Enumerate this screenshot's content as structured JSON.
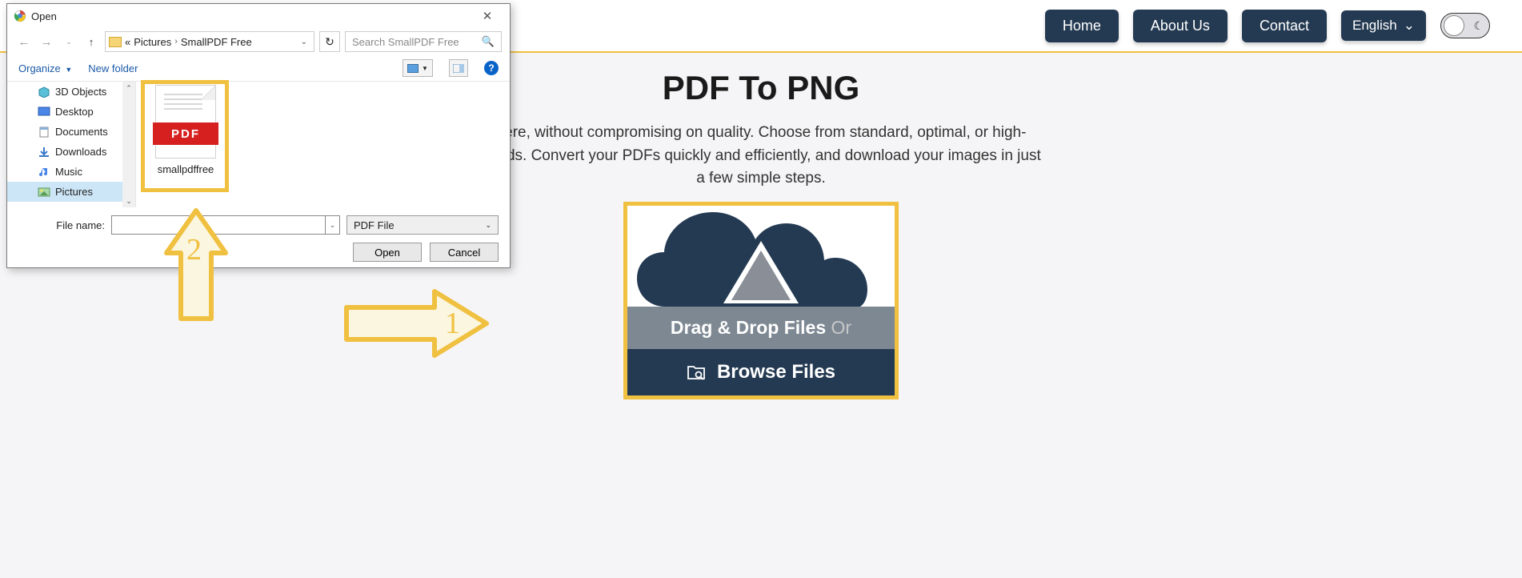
{
  "nav": {
    "home": "Home",
    "about": "About Us",
    "contact": "Contact",
    "language": "English"
  },
  "page": {
    "title": "PDF To PNG",
    "desc_line1": "here, without compromising on quality. Choose from standard, optimal, or high-",
    "desc_line2": "needs. Convert your PDFs quickly and efficiently, and download your images in just",
    "desc_line3": "a few simple steps."
  },
  "dropzone": {
    "dragdrop": "Drag & Drop Files",
    "or": "Or",
    "browse": "Browse Files"
  },
  "dialog": {
    "title": "Open",
    "breadcrumb": {
      "root": "Pictures",
      "current": "SmallPDF Free",
      "prefix": "«"
    },
    "search_placeholder": "Search SmallPDF Free",
    "organize": "Organize",
    "new_folder": "New folder",
    "tree": {
      "items": [
        {
          "label": "3D Objects",
          "icon": "cube"
        },
        {
          "label": "Desktop",
          "icon": "desktop"
        },
        {
          "label": "Documents",
          "icon": "doc"
        },
        {
          "label": "Downloads",
          "icon": "download"
        },
        {
          "label": "Music",
          "icon": "music"
        },
        {
          "label": "Pictures",
          "icon": "picture",
          "selected": true
        }
      ]
    },
    "file": {
      "name": "smallpdffree",
      "badge": "PDF"
    },
    "filename_label": "File name:",
    "filetype": "PDF File",
    "open": "Open",
    "cancel": "Cancel"
  },
  "annotations": {
    "num1": "1",
    "num2": "2"
  }
}
